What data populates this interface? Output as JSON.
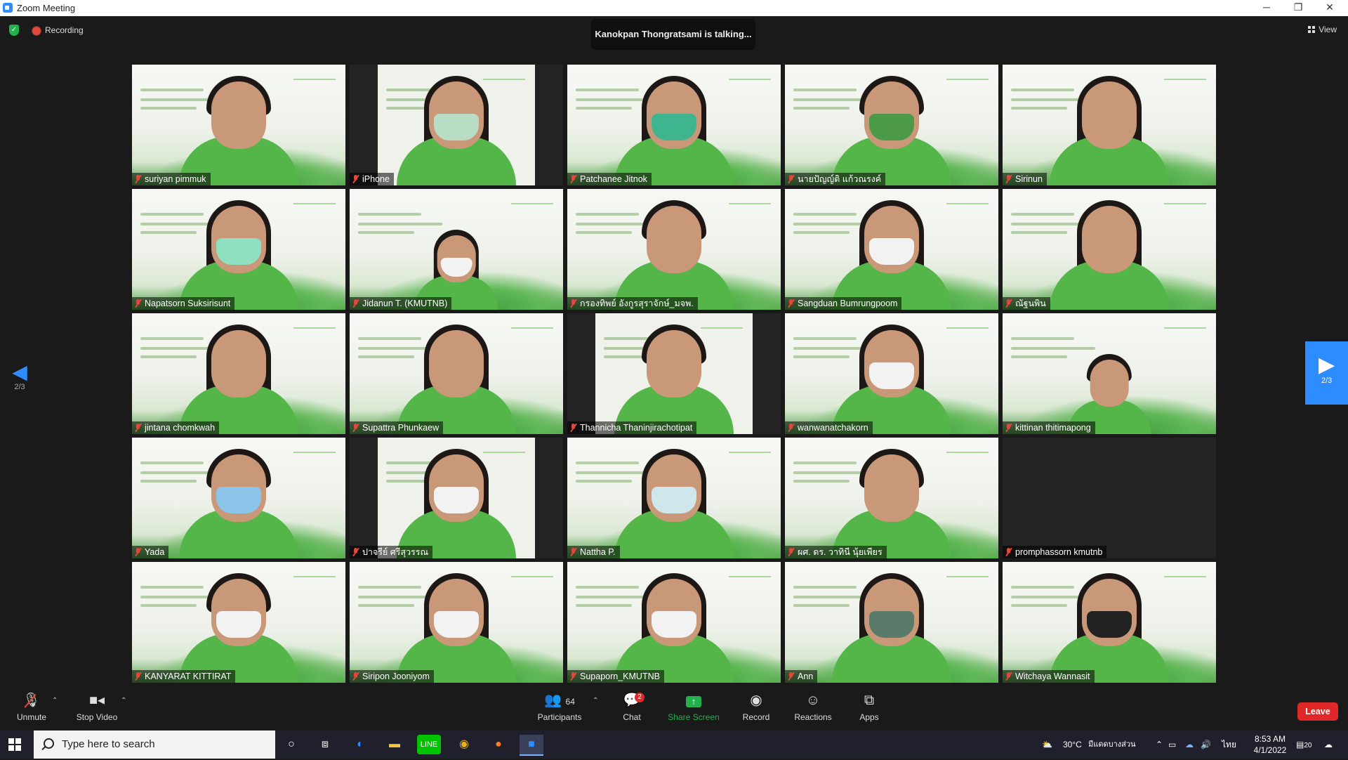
{
  "window": {
    "title": "Zoom Meeting",
    "minimize": "─",
    "restore": "❐",
    "close": "✕"
  },
  "topbar": {
    "recording_label": "Recording",
    "talking": "Kanokpan Thongratsami is talking...",
    "view_label": "View"
  },
  "pagination": {
    "left_page": "2/3",
    "right_page": "2/3"
  },
  "participants": [
    {
      "name": "suriyan pimmuk",
      "video": true,
      "mask": "",
      "hair": "short"
    },
    {
      "name": "iPhone",
      "video": true,
      "mask": "#b9dcc4",
      "hair": "long",
      "pillar": true
    },
    {
      "name": "Patchanee Jitnok",
      "video": true,
      "mask": "#3fb58f",
      "hair": "long"
    },
    {
      "name": "นายปัญญ์ติ แก้วณรงค์",
      "video": true,
      "mask": "#4c9a48",
      "hair": "short"
    },
    {
      "name": "Sirinun",
      "video": true,
      "mask": "",
      "hair": "long"
    },
    {
      "name": "Napatsorn Suksirisunt",
      "video": true,
      "mask": "#8fe0c0",
      "hair": "long"
    },
    {
      "name": "Jidanun T. (KMUTNB)",
      "video": true,
      "mask": "#f2f2f2",
      "hair": "long",
      "small": true
    },
    {
      "name": "กรองทิพย์ อังกูรสุราจักษ์_มจพ.",
      "video": true,
      "mask": "",
      "hair": "short"
    },
    {
      "name": "Sangduan Bumrungpoom",
      "video": true,
      "mask": "#f2f2f2",
      "hair": "long"
    },
    {
      "name": "ณัฐนพิน",
      "video": true,
      "mask": "",
      "hair": "long"
    },
    {
      "name": "jintana chomkwah",
      "video": true,
      "mask": "",
      "hair": "long"
    },
    {
      "name": "Supattra Phunkaew",
      "video": true,
      "mask": "",
      "hair": "long"
    },
    {
      "name": "Thannicha Thaninjirachotipat",
      "video": true,
      "mask": "",
      "hair": "short",
      "pillar": true
    },
    {
      "name": "wanwanatchakorn",
      "video": true,
      "mask": "#f2f2f2",
      "hair": "long"
    },
    {
      "name": "kittinan thitimapong",
      "video": true,
      "mask": "",
      "hair": "short",
      "small": true
    },
    {
      "name": "Yada",
      "video": true,
      "mask": "#8cc4ea",
      "hair": "short"
    },
    {
      "name": "ปาจรีย์ ศรีสุวรรณ",
      "video": true,
      "mask": "#f2f2f2",
      "hair": "long",
      "pillar": true
    },
    {
      "name": "Nattha P.",
      "video": true,
      "mask": "#cfe7ea",
      "hair": "long"
    },
    {
      "name": "ผศ. ดร. วาทินี นุ้ยเพียร",
      "video": true,
      "mask": "",
      "hair": "short"
    },
    {
      "name": "promphassorn kmutnb",
      "video": false,
      "mask": "",
      "hair": ""
    },
    {
      "name": "KANYARAT KITTIRAT",
      "video": true,
      "mask": "#f2f2f2",
      "hair": "short"
    },
    {
      "name": "Siripon Jooniyom",
      "video": true,
      "mask": "#f2f2f2",
      "hair": "long"
    },
    {
      "name": "Supaporn_KMUTNB",
      "video": true,
      "mask": "#f2f2f2",
      "hair": "long"
    },
    {
      "name": "Ann",
      "video": true,
      "mask": "#5a7a6a",
      "hair": "long"
    },
    {
      "name": "Witchaya Wannasit",
      "video": true,
      "mask": "#222222",
      "hair": "long"
    }
  ],
  "toolbar": {
    "unmute": "Unmute",
    "stop_video": "Stop Video",
    "participants": "Participants",
    "participants_count": "64",
    "chat": "Chat",
    "chat_badge": "2",
    "share_screen": "Share Screen",
    "record": "Record",
    "reactions": "Reactions",
    "apps": "Apps",
    "leave": "Leave"
  },
  "taskbar": {
    "search_placeholder": "Type here to search",
    "weather": "30°C",
    "weather_desc": "มีแดดบางส่วน",
    "language": "ไทย",
    "time": "8:53 AM",
    "date": "4/1/2022",
    "notif_count": "20"
  },
  "colors": {
    "accent": "#2D8CFF",
    "leave": "#E02828",
    "share": "#22B14C",
    "tile_green": "#54B548"
  }
}
